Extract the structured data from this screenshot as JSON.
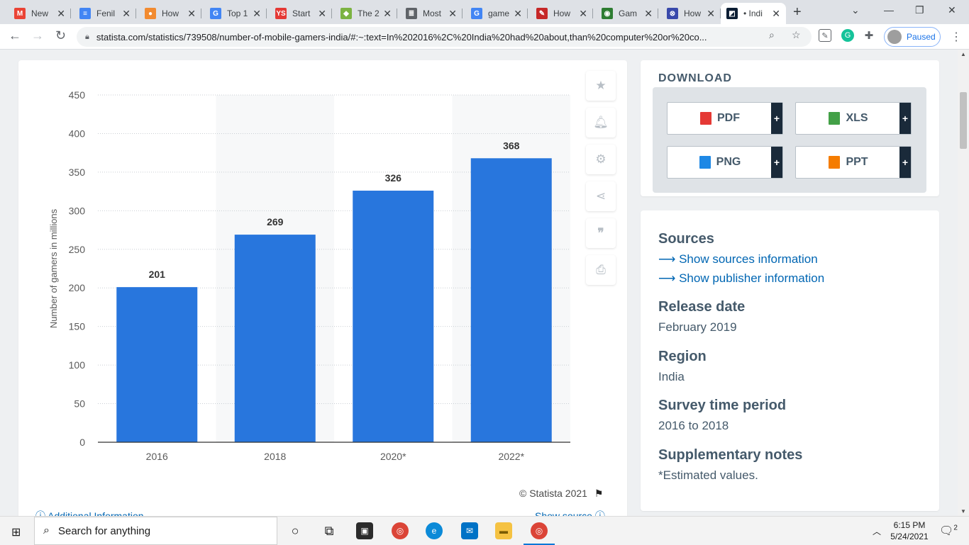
{
  "browser": {
    "tabs": [
      {
        "title": "New",
        "favicon": "gmail-icon",
        "color": "#ea4335",
        "glyph": "M"
      },
      {
        "title": "Fenil",
        "favicon": "docs-icon",
        "color": "#4285f4",
        "glyph": "≡"
      },
      {
        "title": "How",
        "favicon": "profile-icon",
        "color": "#f28b30",
        "glyph": "●"
      },
      {
        "title": "Top 1",
        "favicon": "google-icon",
        "color": "#4285f4",
        "glyph": "G"
      },
      {
        "title": "Start",
        "favicon": "ys-icon",
        "color": "#e53935",
        "glyph": "YS"
      },
      {
        "title": "The 2",
        "favicon": "leaf-icon",
        "color": "#7cb342",
        "glyph": "◆"
      },
      {
        "title": "Most",
        "favicon": "list-icon",
        "color": "#5f6368",
        "glyph": "≣"
      },
      {
        "title": "game",
        "favicon": "google-icon",
        "color": "#4285f4",
        "glyph": "G"
      },
      {
        "title": "How",
        "favicon": "quill-icon",
        "color": "#c62828",
        "glyph": "✎"
      },
      {
        "title": "Gam",
        "favicon": "game-icon",
        "color": "#2e7d32",
        "glyph": "◉"
      },
      {
        "title": "How",
        "favicon": "controller-icon",
        "color": "#3949ab",
        "glyph": "⊗"
      },
      {
        "title": "• Indi",
        "favicon": "statista-icon",
        "color": "#0b1d33",
        "glyph": "◩",
        "active": true
      }
    ],
    "url": "statista.com/statistics/739508/number-of-mobile-gamers-india/#:~:text=In%202016%2C%20India%20had%20about,than%20computer%20or%20co...",
    "profile_status": "Paused"
  },
  "chart_data": {
    "type": "bar",
    "categories": [
      "2016",
      "2018",
      "2020*",
      "2022*"
    ],
    "values": [
      201,
      269,
      326,
      368
    ],
    "title": "",
    "xlabel": "",
    "ylabel": "Number of gamers in millions",
    "ylim": [
      0,
      450
    ],
    "yticks": [
      0,
      50,
      100,
      150,
      200,
      250,
      300,
      350,
      400,
      450
    ],
    "grid": true,
    "bar_color": "#2876dd"
  },
  "chart_footer": {
    "copyright": "© Statista 2021",
    "additional_info": "Additional Information",
    "show_source": "Show source"
  },
  "download": {
    "title": "DOWNLOAD",
    "buttons": [
      {
        "label": "PDF",
        "icon": "pdf-icon",
        "color": "#e53935"
      },
      {
        "label": "XLS",
        "icon": "xls-icon",
        "color": "#43a047"
      },
      {
        "label": "PNG",
        "icon": "png-icon",
        "color": "#1e88e5"
      },
      {
        "label": "PPT",
        "icon": "ppt-icon",
        "color": "#f57c00"
      }
    ],
    "plus": "+"
  },
  "info": {
    "sources_heading": "Sources",
    "sources_link": "⟶ Show sources information",
    "publisher_link": "⟶ Show publisher information",
    "release_heading": "Release date",
    "release_value": "February 2019",
    "region_heading": "Region",
    "region_value": "India",
    "period_heading": "Survey time period",
    "period_value": "2016 to 2018",
    "notes_heading": "Supplementary notes",
    "notes_value": "*Estimated values."
  },
  "taskbar": {
    "search_placeholder": "Search for anything",
    "time": "6:15 PM",
    "date": "5/24/2021",
    "notifications": "2"
  }
}
